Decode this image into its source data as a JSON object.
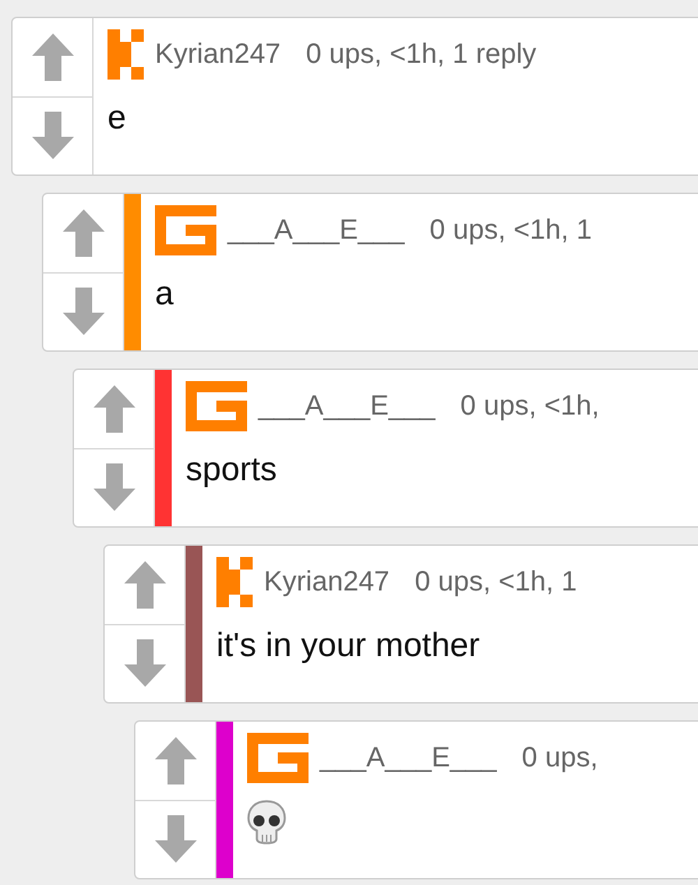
{
  "comments": [
    {
      "avatar": {
        "kind": "k"
      },
      "author": "Kyrian247",
      "meta": "0 ups, <1h, 1 reply",
      "body": {
        "kind": "text",
        "text": "e"
      },
      "children": [
        {
          "avatar": {
            "kind": "g"
          },
          "author": "___A___E___",
          "meta": "0 ups, <1h, 1",
          "color": "#ff8c00",
          "body": {
            "kind": "text",
            "text": "a"
          },
          "children": [
            {
              "avatar": {
                "kind": "g"
              },
              "author": "___A___E___",
              "meta": "0 ups, <1h,",
              "color": "#ff3333",
              "body": {
                "kind": "text",
                "text": "sports"
              },
              "children": [
                {
                  "avatar": {
                    "kind": "k"
                  },
                  "author": "Kyrian247",
                  "meta": "0 ups, <1h, 1",
                  "color": "#995555",
                  "body": {
                    "kind": "text",
                    "text": "it's in your mother"
                  },
                  "children": [
                    {
                      "avatar": {
                        "kind": "g"
                      },
                      "author": "___A___E___",
                      "meta": "0 ups,",
                      "color": "#dd00cc",
                      "body": {
                        "kind": "skull"
                      }
                    }
                  ]
                }
              ]
            }
          ]
        }
      ]
    }
  ]
}
